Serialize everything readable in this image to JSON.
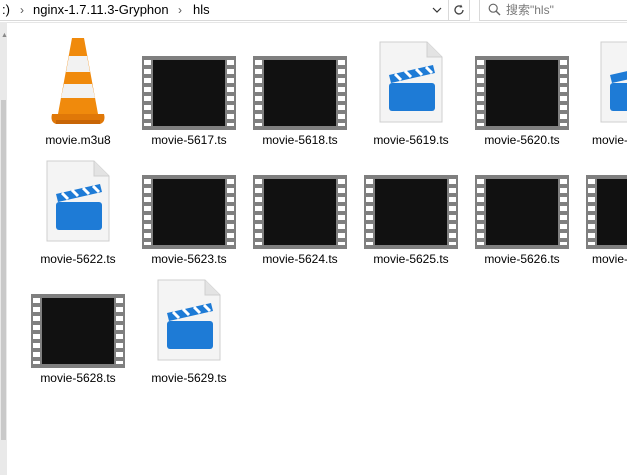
{
  "addressbar": {
    "drive_fragment": ":)",
    "crumbs": [
      "nginx-1.7.11.3-Gryphon",
      "hls"
    ]
  },
  "search": {
    "placeholder": "搜索\"hls\""
  },
  "files": [
    {
      "name": "movie.m3u8",
      "type": "vlc-playlist-icon"
    },
    {
      "name": "movie-5617.ts",
      "type": "video-thumbnail"
    },
    {
      "name": "movie-5618.ts",
      "type": "video-thumbnail"
    },
    {
      "name": "movie-5619.ts",
      "type": "video-file-icon"
    },
    {
      "name": "movie-5620.ts",
      "type": "video-thumbnail"
    },
    {
      "name": "movie-",
      "type": "video-file-icon"
    },
    {
      "name": "movie-5622.ts",
      "type": "video-file-icon"
    },
    {
      "name": "movie-5623.ts",
      "type": "video-thumbnail"
    },
    {
      "name": "movie-5624.ts",
      "type": "video-thumbnail"
    },
    {
      "name": "movie-5625.ts",
      "type": "video-thumbnail"
    },
    {
      "name": "movie-5626.ts",
      "type": "video-thumbnail"
    },
    {
      "name": "movie-",
      "type": "video-thumbnail"
    },
    {
      "name": "movie-5628.ts",
      "type": "video-thumbnail"
    },
    {
      "name": "movie-5629.ts",
      "type": "video-file-icon"
    }
  ],
  "colors": {
    "vlc_orange": "#f08a0c",
    "clapper_blue": "#1e7bd6",
    "film_gray": "#7f7f7f",
    "frame_black": "#111111"
  }
}
